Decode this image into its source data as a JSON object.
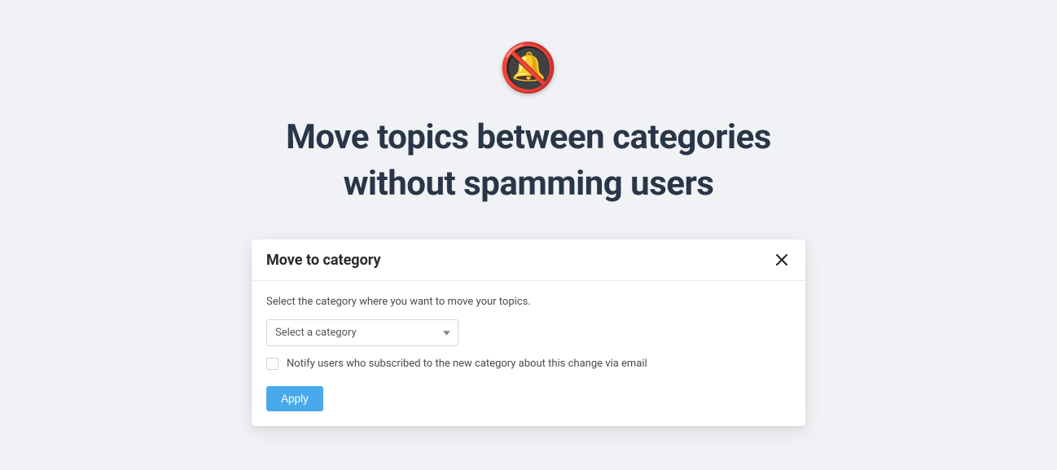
{
  "hero": {
    "headline_line1": "Move topics between categories",
    "headline_line2": "without spamming users"
  },
  "dialog": {
    "title": "Move to category",
    "instruction": "Select the category where you want to move your topics.",
    "select_placeholder": "Select a category",
    "checkbox_label": "Notify users who subscribed to the new category about this change via email",
    "apply_label": "Apply"
  }
}
